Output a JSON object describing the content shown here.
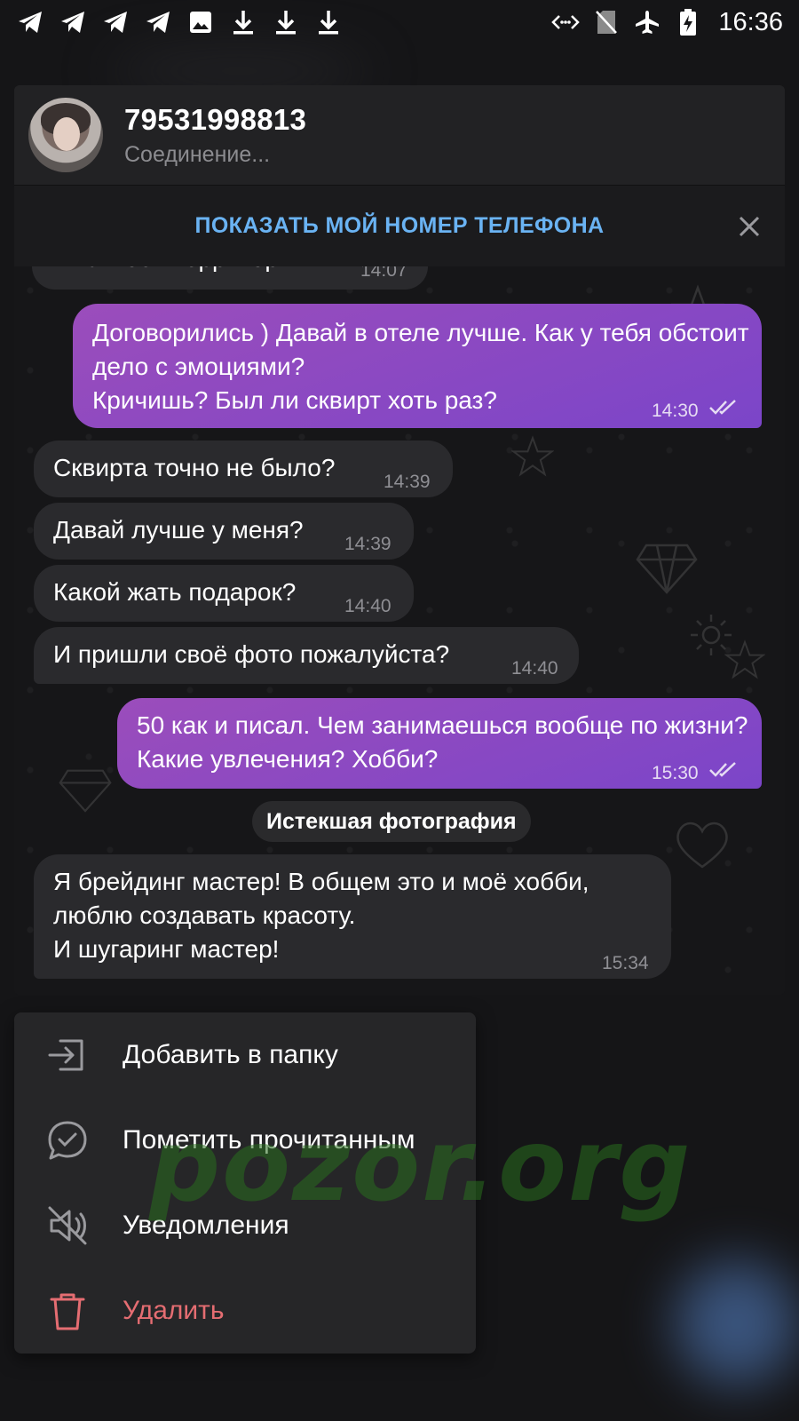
{
  "status_bar": {
    "left_icons": [
      "telegram-icon",
      "telegram-icon",
      "telegram-icon",
      "telegram-icon",
      "image-icon",
      "download-icon",
      "download-icon",
      "download-icon"
    ],
    "right_icons": [
      "data-saver-icon",
      "no-sim-icon",
      "airplane-icon",
      "battery-charging-icon"
    ],
    "time": "16:36"
  },
  "chat": {
    "name": "79531998813",
    "status": "Соединение...",
    "banner": "ПОКАЗАТЬ МОЙ НОМЕР ТЕЛЕФОНА"
  },
  "messages": [
    {
      "dir": "in",
      "text": "На моей территории?",
      "time": "14:07"
    },
    {
      "dir": "out",
      "text": "Договорились ) Давай в отеле лучше. Как у тебя обстоит дело с эмоциями?\nКричишь? Был ли сквирт хоть раз?",
      "time": "14:30"
    },
    {
      "dir": "in",
      "text": "Сквирта точно не было?",
      "time": "14:39"
    },
    {
      "dir": "in",
      "text": "Давай лучше у меня?",
      "time": "14:39"
    },
    {
      "dir": "in",
      "text": "Какой жать подарок?",
      "time": "14:40"
    },
    {
      "dir": "in",
      "text": "И пришли своё фото пожалуйста?",
      "time": "14:40"
    },
    {
      "dir": "out",
      "text": "50 как и писал. Чем занимаешься вообще по жизни? Какие увлечения? Хобби?",
      "time": "15:30"
    },
    {
      "dir": "in",
      "text": "Я брейдинг мастер! В общем это и моё хобби, люблю создавать красоту.\nИ шугаринг мастер!",
      "time": "15:34"
    }
  ],
  "service_message": "Истекшая фотография",
  "menu": [
    {
      "label": "Добавить в папку",
      "icon": "add-to-folder-icon"
    },
    {
      "label": "Пометить прочитанным",
      "icon": "mark-read-icon"
    },
    {
      "label": "Уведомления",
      "icon": "mute-icon"
    },
    {
      "label": "Удалить",
      "icon": "delete-icon"
    }
  ],
  "watermark": "pozor.org",
  "colors": {
    "accent_link": "#6ab3f3",
    "outgoing_bubble": "#8f4ac0",
    "incoming_bubble": "#2a2a2d",
    "danger": "#e56d72"
  }
}
